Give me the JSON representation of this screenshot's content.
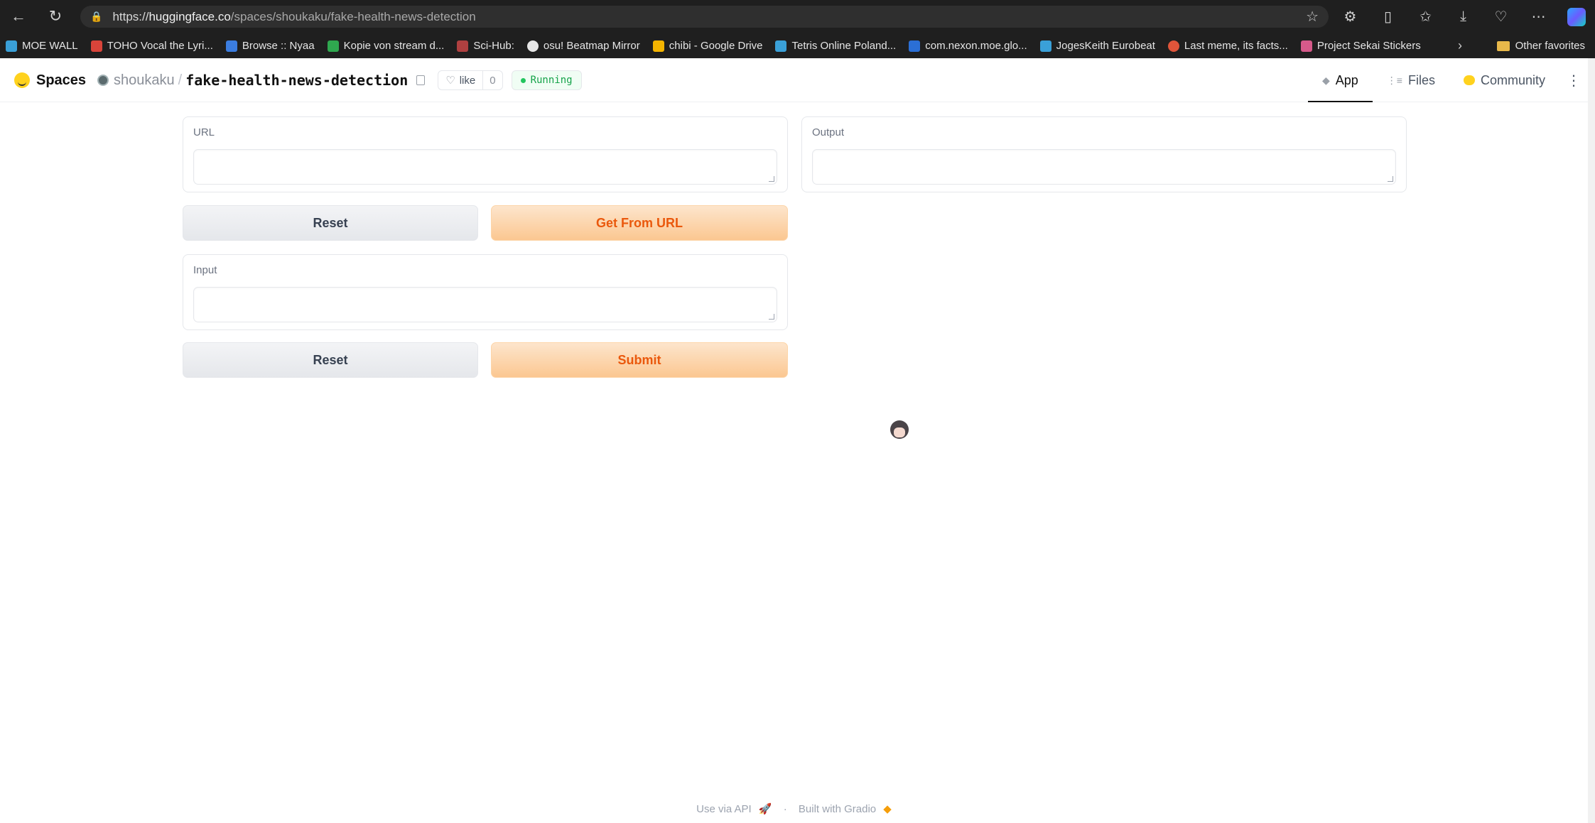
{
  "browser": {
    "url_scheme": "https://",
    "url_host": "huggingface.co",
    "url_path": "/spaces/shoukaku/fake-health-news-detection",
    "bookmarks": [
      {
        "label": "MOE WALL",
        "color": "#3aa0d8"
      },
      {
        "label": "TOHO Vocal the Lyri...",
        "color": "#d9443a"
      },
      {
        "label": "Browse :: Nyaa",
        "color": "#3b7de0"
      },
      {
        "label": "Kopie von stream d...",
        "color": "#2fa84f"
      },
      {
        "label": "Sci-Hub:",
        "color": "#b04040"
      },
      {
        "label": "osu! Beatmap Mirror",
        "color": "#e6e6e6"
      },
      {
        "label": "chibi - Google Drive",
        "color": "#f4b400"
      },
      {
        "label": "Tetris Online Poland...",
        "color": "#3aa0d8"
      },
      {
        "label": "com.nexon.moe.glo...",
        "color": "#2b6fd6"
      },
      {
        "label": "JogesKeith Eurobeat",
        "color": "#3aa0d8"
      },
      {
        "label": "Last meme, its facts...",
        "color": "#e0553a"
      },
      {
        "label": "Project Sekai Stickers",
        "color": "#d65a8a"
      }
    ],
    "other_favorites": "Other favorites"
  },
  "header": {
    "spaces_label": "Spaces",
    "owner": "shoukaku",
    "repo": "fake-health-news-detection",
    "like_label": "like",
    "like_count": "0",
    "status": "Running",
    "tabs": [
      {
        "label": "App",
        "active": true
      },
      {
        "label": "Files",
        "active": false
      },
      {
        "label": "Community",
        "active": false
      }
    ]
  },
  "app": {
    "url_box": {
      "label": "URL",
      "value": ""
    },
    "output_box": {
      "label": "Output",
      "value": ""
    },
    "input_box": {
      "label": "Input",
      "value": ""
    },
    "reset_1": "Reset",
    "get_from_url": "Get From URL",
    "reset_2": "Reset",
    "submit": "Submit"
  },
  "footer": {
    "api": "Use via API",
    "sep": "·",
    "built_with": "Built with Gradio"
  },
  "colors": {
    "primary_text": "#ea580c",
    "running": "#16a34a"
  }
}
